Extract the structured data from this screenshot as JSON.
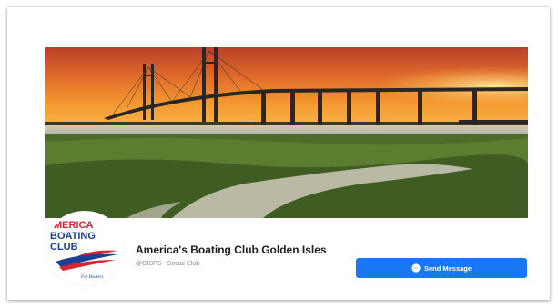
{
  "page": {
    "name": "America's Boating Club Golden Isles",
    "meta": "@GISPS · Social Club"
  },
  "logo": {
    "line1": "MERICA",
    "line2": "BOATING",
    "line3": "CLUB",
    "tagline": "For Boaters"
  },
  "actions": {
    "send_message_label": "Send Message",
    "send_message_icon": "messenger-icon"
  },
  "colors": {
    "accent": "#1877f2",
    "logo_red": "#d7262e",
    "logo_blue": "#1b3f95"
  }
}
